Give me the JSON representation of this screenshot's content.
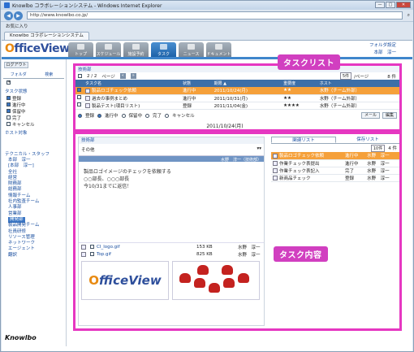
{
  "browser": {
    "title": "Knowlbo コラボレーションシステム - Windows Internet Explorer",
    "window_buttons": [
      "—",
      "□",
      "✕"
    ],
    "url": "http://www.knowlbo.co.jp/",
    "favorites": "お気に入り",
    "tab": "Knowlbo コラボレーションシステム",
    "nav_back": "◀",
    "nav_fwd": "▶",
    "search_icon": "⌕"
  },
  "app": {
    "logo_main": "ffice",
    "logo_o": "O",
    "logo_view": "View",
    "nav": [
      {
        "label": "トップ"
      },
      {
        "label": "スケジュール"
      },
      {
        "label": "施設予約"
      },
      {
        "label": "タスク"
      },
      {
        "label": "ニュース"
      },
      {
        "label": "ドキュメント"
      }
    ],
    "toplinks": {
      "folder": "フォルダ設定",
      "user": "本部　淳一",
      "help": "ヘルプ"
    }
  },
  "sidebar": {
    "logout": "ログアウト",
    "tabs": [
      "フォルダ",
      "検索"
    ],
    "add": "+",
    "task_state": "タスク状態",
    "states": [
      {
        "label": "登録",
        "checked": true
      },
      {
        "label": "進行中",
        "checked": true
      },
      {
        "label": "保留中",
        "checked": true
      },
      {
        "label": "完了",
        "checked": false
      },
      {
        "label": "キャンセル",
        "checked": false
      }
    ],
    "assignee_section": "ホスト対象",
    "tech_section": "テクニカル・スタッフ",
    "tree": [
      "本部　淳一",
      "[本部　淳一]",
      "全社",
      "経営",
      "財務部",
      "総務部",
      "情報チーム",
      "社内監査チーム",
      "人事部",
      "営業部",
      "開発部",
      "製品開発チーム",
      "社員研修",
      "リソース管理",
      "ネットワーク",
      "エージェント",
      "翻訳"
    ],
    "footer_logo": "Knowlbo"
  },
  "task_list": {
    "label": "タスクリスト",
    "header": "技術部",
    "page": "2 / 2",
    "page_label": "ページ",
    "count_select": "5件",
    "per_page": "/ページ",
    "total": "8 件",
    "columns": [
      "タスク名",
      "状態",
      "期限 ▲",
      "重要度",
      "ホスト"
    ],
    "rows": [
      {
        "name": "製品ロゴチェック依頼",
        "status": "進行中",
        "due": "2011/10/24(月)",
        "priority": "★★",
        "host": "水野（チーム外部）"
      },
      {
        "name": "過去の事例まとめ",
        "status": "進行中",
        "due": "2011/10/31(月)",
        "priority": "★★",
        "host": "水野（チーム外部）"
      },
      {
        "name": "製品テスト(項目リスト)",
        "status": "登録",
        "due": "2011/11/04(金)",
        "priority": "★★★★",
        "host": "水野（チーム外部）"
      }
    ],
    "filter": [
      "登録",
      "進行中",
      "保留中",
      "完了",
      "キャンセル"
    ],
    "date": "2011/10/24(月)",
    "buttons": [
      "メール",
      "編集"
    ]
  },
  "task_content": {
    "label": "タスク内容",
    "header": "技術部",
    "title": "その他",
    "meta": "水野　淳一（技術部）",
    "body": [
      "製品ロゴイメージのチェックを依頼する",
      "○○部長、○○○部長",
      "",
      "今10/31までに返信！"
    ],
    "attachments": [
      {
        "name": "CI_logo.gif",
        "size": "153 KB",
        "owner": "水野　淳一"
      },
      {
        "name": "Top.gif",
        "size": "825 KB",
        "owner": "水野　淳一"
      }
    ],
    "right_tabs": [
      "関連リスト",
      "保存リスト"
    ],
    "right_count": "10件",
    "right_total": "4 件",
    "related": [
      {
        "name": "製品ロゴチェック依頼",
        "status": "進行中",
        "host": "水野　淳一"
      },
      {
        "name": "作業チェック表提出",
        "status": "進行中",
        "host": "水野　淳一"
      },
      {
        "name": "作業チェック表記入",
        "status": "完了",
        "host": "水野　淳一"
      },
      {
        "name": "新商品チェック",
        "status": "登録",
        "host": "水野　淳一"
      }
    ]
  }
}
